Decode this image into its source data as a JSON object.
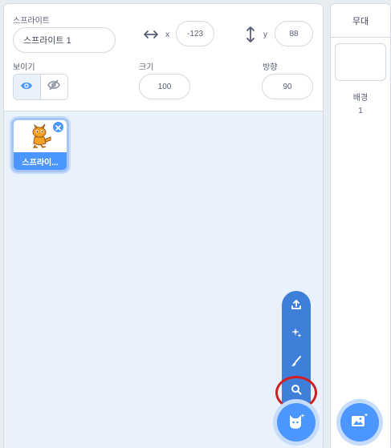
{
  "sprite_info": {
    "sprite_label": "스프라이트",
    "sprite_name": "스프라이트 1",
    "x_label": "x",
    "x_value": "-123",
    "y_label": "y",
    "y_value": "88",
    "show_label": "보이기",
    "size_label": "크기",
    "size_value": "100",
    "direction_label": "방향",
    "direction_value": "90"
  },
  "sprite_list": [
    {
      "name": "스프라이...",
      "selected": true
    }
  ],
  "sprite_menu": {
    "items": [
      "upload-icon",
      "surprise-icon",
      "paint-icon",
      "search-icon"
    ],
    "main": "cat-icon"
  },
  "stage": {
    "title": "무대",
    "backdrop_label": "배경",
    "backdrop_count": "1",
    "main": "backdrop-add-icon"
  },
  "colors": {
    "accent": "#4c97ff",
    "accent_dark": "#3d7fd9",
    "highlight": "#d21f1f",
    "text": "#575e75"
  }
}
